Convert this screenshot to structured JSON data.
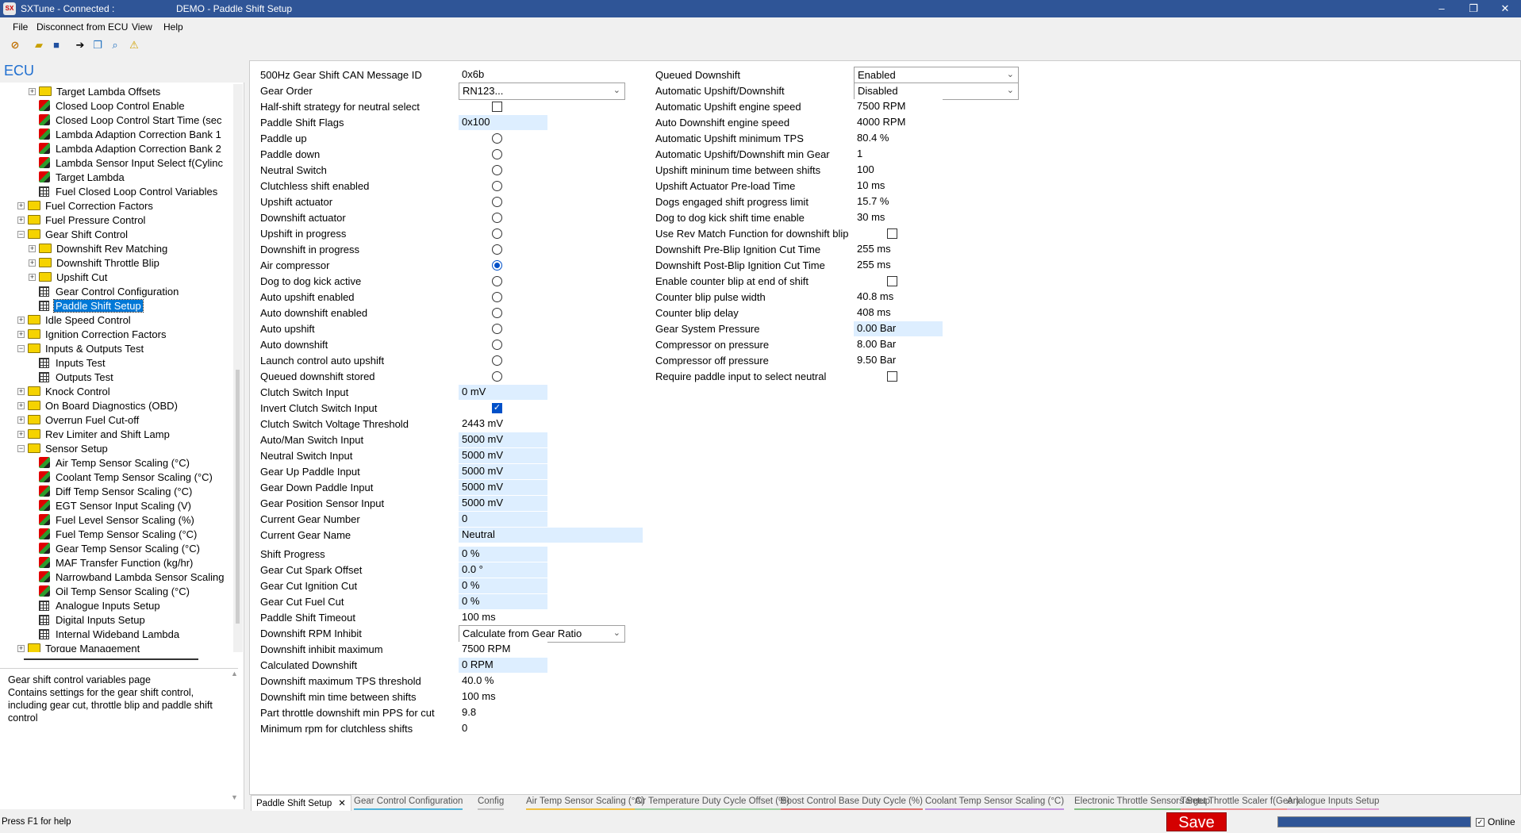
{
  "title_bar": {
    "app_title": "SXTune - Connected :",
    "page_title": "DEMO - Paddle Shift Setup",
    "minimize": "–",
    "maximize": "❐",
    "close": "✕"
  },
  "menu": [
    "File",
    "Disconnect from ECU",
    "View",
    "Help"
  ],
  "toolbar_icons": [
    "disconnect-icon",
    "open-folder-icon",
    "save-icon",
    "navigate-icon",
    "copy-icon",
    "search-icon",
    "alert-icon"
  ],
  "ecu_header": "ECU",
  "tree": [
    {
      "level": 2,
      "type": "folder",
      "label": "Target Lambda Offsets",
      "expander": "+"
    },
    {
      "level": 2,
      "type": "cube",
      "label": "Closed Loop Control Enable"
    },
    {
      "level": 2,
      "type": "cube",
      "label": "Closed Loop Control Start Time (sec"
    },
    {
      "level": 2,
      "type": "cube",
      "label": "Lambda Adaption Correction Bank 1"
    },
    {
      "level": 2,
      "type": "cube",
      "label": "Lambda Adaption Correction Bank 2"
    },
    {
      "level": 2,
      "type": "cube",
      "label": "Lambda Sensor Input Select f(Cylinc"
    },
    {
      "level": 2,
      "type": "cube",
      "label": "Target Lambda"
    },
    {
      "level": 2,
      "type": "table",
      "label": "Fuel Closed Loop Control Variables"
    },
    {
      "level": 1,
      "type": "folder",
      "label": "Fuel Correction Factors",
      "expander": "+"
    },
    {
      "level": 1,
      "type": "folder",
      "label": "Fuel Pressure Control",
      "expander": "+"
    },
    {
      "level": 1,
      "type": "folder",
      "label": "Gear Shift Control",
      "expander": "−"
    },
    {
      "level": 2,
      "type": "folder",
      "label": "Downshift Rev Matching",
      "expander": "+"
    },
    {
      "level": 2,
      "type": "folder",
      "label": "Downshift Throttle Blip",
      "expander": "+"
    },
    {
      "level": 2,
      "type": "folder",
      "label": "Upshift Cut",
      "expander": "+"
    },
    {
      "level": 2,
      "type": "table",
      "label": "Gear Control Configuration"
    },
    {
      "level": 2,
      "type": "table",
      "label": "Paddle Shift Setup",
      "selected": true
    },
    {
      "level": 1,
      "type": "folder",
      "label": "Idle Speed Control",
      "expander": "+"
    },
    {
      "level": 1,
      "type": "folder",
      "label": "Ignition Correction Factors",
      "expander": "+"
    },
    {
      "level": 1,
      "type": "folder",
      "label": "Inputs & Outputs Test",
      "expander": "−"
    },
    {
      "level": 2,
      "type": "table",
      "label": "Inputs Test"
    },
    {
      "level": 2,
      "type": "table",
      "label": "Outputs Test"
    },
    {
      "level": 1,
      "type": "folder",
      "label": "Knock Control",
      "expander": "+"
    },
    {
      "level": 1,
      "type": "folder",
      "label": "On Board Diagnostics (OBD)",
      "expander": "+"
    },
    {
      "level": 1,
      "type": "folder",
      "label": "Overrun Fuel Cut-off",
      "expander": "+"
    },
    {
      "level": 1,
      "type": "folder",
      "label": "Rev Limiter and Shift Lamp",
      "expander": "+"
    },
    {
      "level": 1,
      "type": "folder",
      "label": "Sensor Setup",
      "expander": "−"
    },
    {
      "level": 2,
      "type": "cube",
      "label": "Air Temp Sensor Scaling (°C)"
    },
    {
      "level": 2,
      "type": "cube",
      "label": "Coolant Temp Sensor Scaling (°C)"
    },
    {
      "level": 2,
      "type": "cube",
      "label": "Diff Temp Sensor Scaling (°C)"
    },
    {
      "level": 2,
      "type": "cube",
      "label": "EGT Sensor Input Scaling (V)"
    },
    {
      "level": 2,
      "type": "cube",
      "label": "Fuel Level Sensor Scaling (%)"
    },
    {
      "level": 2,
      "type": "cube",
      "label": "Fuel Temp Sensor Scaling (°C)"
    },
    {
      "level": 2,
      "type": "cube",
      "label": "Gear Temp Sensor Scaling (°C)"
    },
    {
      "level": 2,
      "type": "cube",
      "label": "MAF Transfer Function (kg/hr)"
    },
    {
      "level": 2,
      "type": "cube",
      "label": "Narrowband Lambda Sensor Scaling"
    },
    {
      "level": 2,
      "type": "cube",
      "label": "Oil Temp Sensor Scaling (°C)"
    },
    {
      "level": 2,
      "type": "table",
      "label": "Analogue Inputs Setup"
    },
    {
      "level": 2,
      "type": "table",
      "label": "Digital Inputs Setup"
    },
    {
      "level": 2,
      "type": "table",
      "label": "Internal Wideband Lambda"
    },
    {
      "level": 1,
      "type": "folder",
      "label": "Torque Management",
      "expander": "+"
    }
  ],
  "description": "Gear shift control variables page\nContains settings for the gear shift control, including gear cut, throttle blip and paddle shift control",
  "left_fields": [
    {
      "label": "500Hz Gear Shift CAN Message ID",
      "kind": "text",
      "value": "0x6b"
    },
    {
      "label": "Gear Order",
      "kind": "select",
      "value": "RN123..."
    },
    {
      "label": "Half-shift strategy for neutral select",
      "kind": "check",
      "checked": false
    },
    {
      "label": "Paddle Shift Flags",
      "kind": "ro",
      "value": "0x100"
    },
    {
      "label": "Paddle up",
      "kind": "radio",
      "checked": false
    },
    {
      "label": "Paddle down",
      "kind": "radio",
      "checked": false
    },
    {
      "label": "Neutral Switch",
      "kind": "radio",
      "checked": false
    },
    {
      "label": "Clutchless shift enabled",
      "kind": "radio",
      "checked": false
    },
    {
      "label": "Upshift actuator",
      "kind": "radio",
      "checked": false
    },
    {
      "label": "Downshift actuator",
      "kind": "radio",
      "checked": false
    },
    {
      "label": "Upshift in progress",
      "kind": "radio",
      "checked": false
    },
    {
      "label": "Downshift in progress",
      "kind": "radio",
      "checked": false
    },
    {
      "label": "Air compressor",
      "kind": "radio",
      "checked": true
    },
    {
      "label": "Dog to dog kick active",
      "kind": "radio",
      "checked": false
    },
    {
      "label": "Auto upshift enabled",
      "kind": "radio",
      "checked": false
    },
    {
      "label": "Auto downshift enabled",
      "kind": "radio",
      "checked": false
    },
    {
      "label": "Auto upshift",
      "kind": "radio",
      "checked": false
    },
    {
      "label": "Auto downshift",
      "kind": "radio",
      "checked": false
    },
    {
      "label": "Launch control auto upshift",
      "kind": "radio",
      "checked": false
    },
    {
      "label": "Queued downshift stored",
      "kind": "radio",
      "checked": false
    },
    {
      "label": "Clutch Switch Input",
      "kind": "ro",
      "value": "0 mV"
    },
    {
      "label": "Invert Clutch Switch Input",
      "kind": "check",
      "checked": true
    },
    {
      "label": "Clutch Switch Voltage Threshold",
      "kind": "text",
      "value": "2443 mV"
    },
    {
      "label": "Auto/Man Switch Input",
      "kind": "ro",
      "value": "5000 mV"
    },
    {
      "label": "Neutral Switch Input",
      "kind": "ro",
      "value": "5000 mV"
    },
    {
      "label": "Gear Up Paddle Input",
      "kind": "ro",
      "value": "5000 mV"
    },
    {
      "label": "Gear Down Paddle Input",
      "kind": "ro",
      "value": "5000 mV"
    },
    {
      "label": "Gear Position Sensor Input",
      "kind": "ro",
      "value": "5000 mV"
    },
    {
      "label": "Current Gear Number",
      "kind": "ro",
      "value": "0"
    },
    {
      "label": "Current Gear Name",
      "kind": "ro-wide",
      "value": "Neutral"
    },
    {
      "label": "Shift Progress",
      "kind": "ro",
      "value": "0 %",
      "gap": true
    },
    {
      "label": "Gear Cut Spark Offset",
      "kind": "ro",
      "value": "0.0 °"
    },
    {
      "label": "Gear Cut Ignition Cut",
      "kind": "ro",
      "value": "0 %"
    },
    {
      "label": "Gear Cut Fuel Cut",
      "kind": "ro",
      "value": "0 %"
    },
    {
      "label": "Paddle Shift Timeout",
      "kind": "text",
      "value": "100 ms"
    },
    {
      "label": "Downshift RPM Inhibit",
      "kind": "select",
      "value": "Calculate from Gear Ratio"
    },
    {
      "label": "Downshift inhibit maximum",
      "kind": "text",
      "value": "7500 RPM"
    },
    {
      "label": "Calculated Downshift",
      "kind": "ro",
      "value": "0 RPM"
    },
    {
      "label": "Downshift maximum TPS threshold",
      "kind": "text",
      "value": "40.0 %"
    },
    {
      "label": "Downshift min time between shifts",
      "kind": "text",
      "value": "100 ms"
    },
    {
      "label": "Part throttle downshift min PPS for cut",
      "kind": "text",
      "value": "9.8"
    },
    {
      "label": "Minimum rpm for clutchless shifts",
      "kind": "text",
      "value": "0"
    }
  ],
  "right_fields": [
    {
      "label": "Queued Downshift",
      "kind": "select",
      "value": "Enabled"
    },
    {
      "label": "Automatic Upshift/Downshift",
      "kind": "select",
      "value": "Disabled"
    },
    {
      "label": "Automatic Upshift engine speed",
      "kind": "text",
      "value": "7500 RPM"
    },
    {
      "label": "Auto Downshift engine speed",
      "kind": "text",
      "value": "4000 RPM"
    },
    {
      "label": "Automatic Upshift minimum TPS",
      "kind": "text",
      "value": "80.4 %"
    },
    {
      "label": "Automatic Upshift/Downshift min Gear",
      "kind": "text",
      "value": "1"
    },
    {
      "label": "Upshift mininum time between shifts",
      "kind": "text",
      "value": "100"
    },
    {
      "label": "Upshift Actuator Pre-load Time",
      "kind": "text",
      "value": "10 ms"
    },
    {
      "label": "Dogs engaged shift progress limit",
      "kind": "text",
      "value": "15.7 %"
    },
    {
      "label": "Dog to dog kick shift time enable",
      "kind": "text",
      "value": "30 ms"
    },
    {
      "label": "Use Rev Match Function for downshift blip",
      "kind": "check",
      "checked": false
    },
    {
      "label": "Downshift Pre-Blip Ignition Cut Time",
      "kind": "text",
      "value": "255 ms"
    },
    {
      "label": "Downshift Post-Blip Ignition Cut Time",
      "kind": "text",
      "value": "255 ms"
    },
    {
      "label": "Enable counter blip at end of shift",
      "kind": "check",
      "checked": false
    },
    {
      "label": "Counter blip pulse width",
      "kind": "text",
      "value": "40.8 ms"
    },
    {
      "label": "Counter blip delay",
      "kind": "text",
      "value": "408 ms"
    },
    {
      "label": "Gear System Pressure",
      "kind": "ro",
      "value": "0.00 Bar"
    },
    {
      "label": "Compressor on pressure",
      "kind": "text",
      "value": "8.00 Bar"
    },
    {
      "label": "Compressor off pressure",
      "kind": "text",
      "value": "9.50 Bar"
    },
    {
      "label": "Require paddle input to select neutral",
      "kind": "check",
      "checked": false
    }
  ],
  "tabs": [
    {
      "label": "Paddle Shift Setup",
      "active": true,
      "color": "#ffffff"
    },
    {
      "label": "Gear Control Configuration",
      "color": "#4fb3d9"
    },
    {
      "label": "Config",
      "color": "#c0c0c0"
    },
    {
      "label": "Air Temp Sensor Scaling (°C)",
      "color": "#f0c040"
    },
    {
      "label": "Air Temperature Duty Cycle Offset (%)",
      "color": "#a0d0a0"
    },
    {
      "label": "Boost Control Base Duty Cycle (%)",
      "color": "#e07070"
    },
    {
      "label": "Coolant Temp Sensor Scaling (°C)",
      "color": "#c090e0"
    },
    {
      "label": "Electronic Throttle Sensors Setup",
      "color": "#80c080"
    },
    {
      "label": "Target Throttle Scaler f(Gear)",
      "color": "#f09090"
    },
    {
      "label": "Analogue Inputs Setup",
      "color": "#e0a0d0"
    }
  ],
  "tab_close": "✕",
  "status": {
    "help_text": "Press F1 for help",
    "save_label": "Save",
    "online_label": "Online",
    "online_checked": true,
    "progress": 1.0
  },
  "colors": {
    "title_bar": "#2f5597",
    "readonly_field": "#ddeeff",
    "save_button": "#d40000",
    "accent": "#0050c8"
  }
}
